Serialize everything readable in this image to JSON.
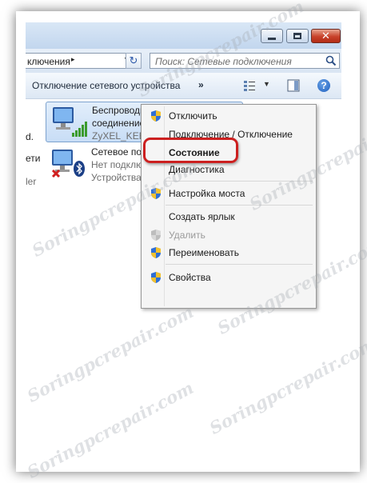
{
  "address": {
    "path_fragment": "ключения",
    "path_arrow": "▸"
  },
  "search": {
    "placeholder": "Поиск: Сетевые подключения"
  },
  "toolbar": {
    "disconnect_label": "Отключение сетевого устройства",
    "more_label": "»",
    "help_label": "?"
  },
  "left_fragments": {
    "line1": "d.",
    "line2": "ети",
    "line3": "ler"
  },
  "items": [
    {
      "name": "Беспроводное сетевое",
      "name2": "соединение",
      "status": "ZyXEL_KEENETIC_"
    },
    {
      "name": "Сетевое подключ",
      "status": "Нет подключения",
      "device": "Устройства Bluet"
    }
  ],
  "context_menu": [
    {
      "label": "Отключить",
      "shield": true
    },
    {
      "label": "Подключение / Отключение",
      "shield": false
    },
    {
      "label": "Состояние",
      "shield": false,
      "bold": true
    },
    {
      "label": "Диагностика",
      "shield": false
    },
    {
      "label": "Настройка моста",
      "shield": true
    },
    {
      "label": "Создать ярлык",
      "shield": false
    },
    {
      "label": "Удалить",
      "shield": true,
      "disabled": true
    },
    {
      "label": "Переименовать",
      "shield": true
    },
    {
      "label": "Свойства",
      "shield": true
    }
  ],
  "watermark": "Soringpcrepair.com",
  "colors": {
    "highlight": "#cc2020",
    "selection": "#c8ddf6",
    "close_button": "#c8412a"
  }
}
